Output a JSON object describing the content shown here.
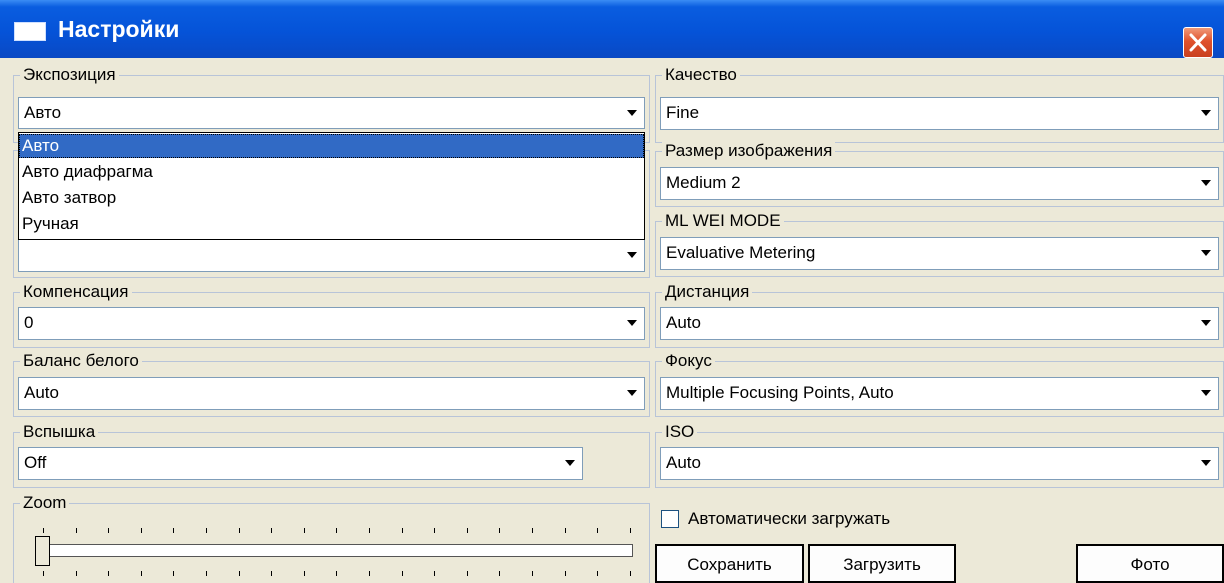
{
  "window": {
    "title": "Настройки",
    "close_label": "✕"
  },
  "exposure": {
    "label": "Экспозиция",
    "value": "Авто",
    "options": [
      "Авто",
      "Авто диафрагма",
      "Авто затвор",
      "Ручная"
    ],
    "selected_index": 0
  },
  "hidden_combo": {
    "value": ""
  },
  "compensation": {
    "label": "Компенсация",
    "value": "0"
  },
  "white_balance": {
    "label": "Баланс белого",
    "value": "Auto"
  },
  "flash": {
    "label": "Вспышка",
    "value": "Off"
  },
  "zoom": {
    "label": "Zoom",
    "position": 0
  },
  "quality": {
    "label": "Качество",
    "value": "Fine"
  },
  "image_size": {
    "label": "Размер изображения",
    "value": "Medium 2"
  },
  "metering": {
    "label": "ML WEI MODE",
    "value": "Evaluative Metering"
  },
  "distance": {
    "label": "Дистанция",
    "value": "Auto"
  },
  "focus": {
    "label": "Фокус",
    "value": "Multiple Focusing Points, Auto"
  },
  "iso": {
    "label": "ISO",
    "value": "Auto"
  },
  "auto_upload": {
    "label": "Автоматически загружать",
    "checked": false
  },
  "buttons": {
    "save": "Сохранить",
    "load": "Загрузить",
    "photo": "Фото"
  },
  "colors": {
    "titlebar": "#0553d8",
    "selection": "#316ac5",
    "face": "#ece9d8",
    "close": "#e0522d"
  },
  "icons": {
    "window": "window-icon",
    "close": "close-icon",
    "arrow": "chevron-down-icon"
  }
}
